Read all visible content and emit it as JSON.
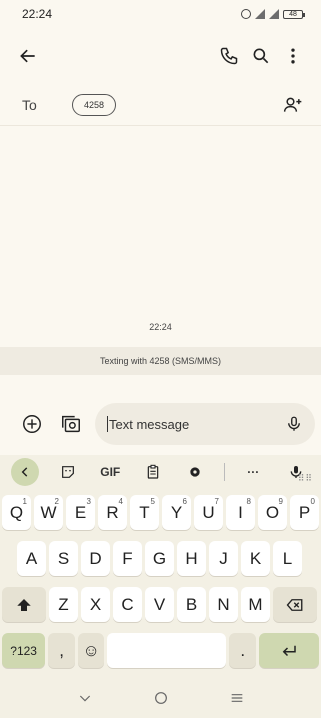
{
  "status": {
    "time": "22:24",
    "battery": "48"
  },
  "app_bar": {
    "back_icon": "arrow-left-icon",
    "call_icon": "phone-icon",
    "search_icon": "search-icon",
    "more_icon": "more-vert-icon"
  },
  "recipients": {
    "to_label": "To",
    "chip": "4258",
    "add_icon": "add-person-icon"
  },
  "conversation": {
    "timestamp": "22:24",
    "info": "Texting with 4258 (SMS/MMS)"
  },
  "compose": {
    "placeholder": "Text message"
  },
  "keyboard": {
    "toolbar": [
      "back",
      "sticker",
      "GIF",
      "clipboard",
      "settings",
      "more",
      "mic"
    ],
    "gif_label": "GIF",
    "more_label": "···",
    "row1": [
      {
        "k": "Q",
        "n": "1"
      },
      {
        "k": "W",
        "n": "2"
      },
      {
        "k": "E",
        "n": "3"
      },
      {
        "k": "R",
        "n": "4"
      },
      {
        "k": "T",
        "n": "5"
      },
      {
        "k": "Y",
        "n": "6"
      },
      {
        "k": "U",
        "n": "7"
      },
      {
        "k": "I",
        "n": "8"
      },
      {
        "k": "O",
        "n": "9"
      },
      {
        "k": "P",
        "n": "0"
      }
    ],
    "row2": [
      "A",
      "S",
      "D",
      "F",
      "G",
      "H",
      "J",
      "K",
      "L"
    ],
    "row3": [
      "Z",
      "X",
      "C",
      "V",
      "B",
      "N",
      "M"
    ],
    "symbols_label": "?123",
    "comma": ",",
    "period": ".",
    "emoji": "☺"
  },
  "colors": {
    "background": "#fbf8f0",
    "keyboard": "#f3f0e4",
    "accent_green": "#cfd8b0"
  }
}
